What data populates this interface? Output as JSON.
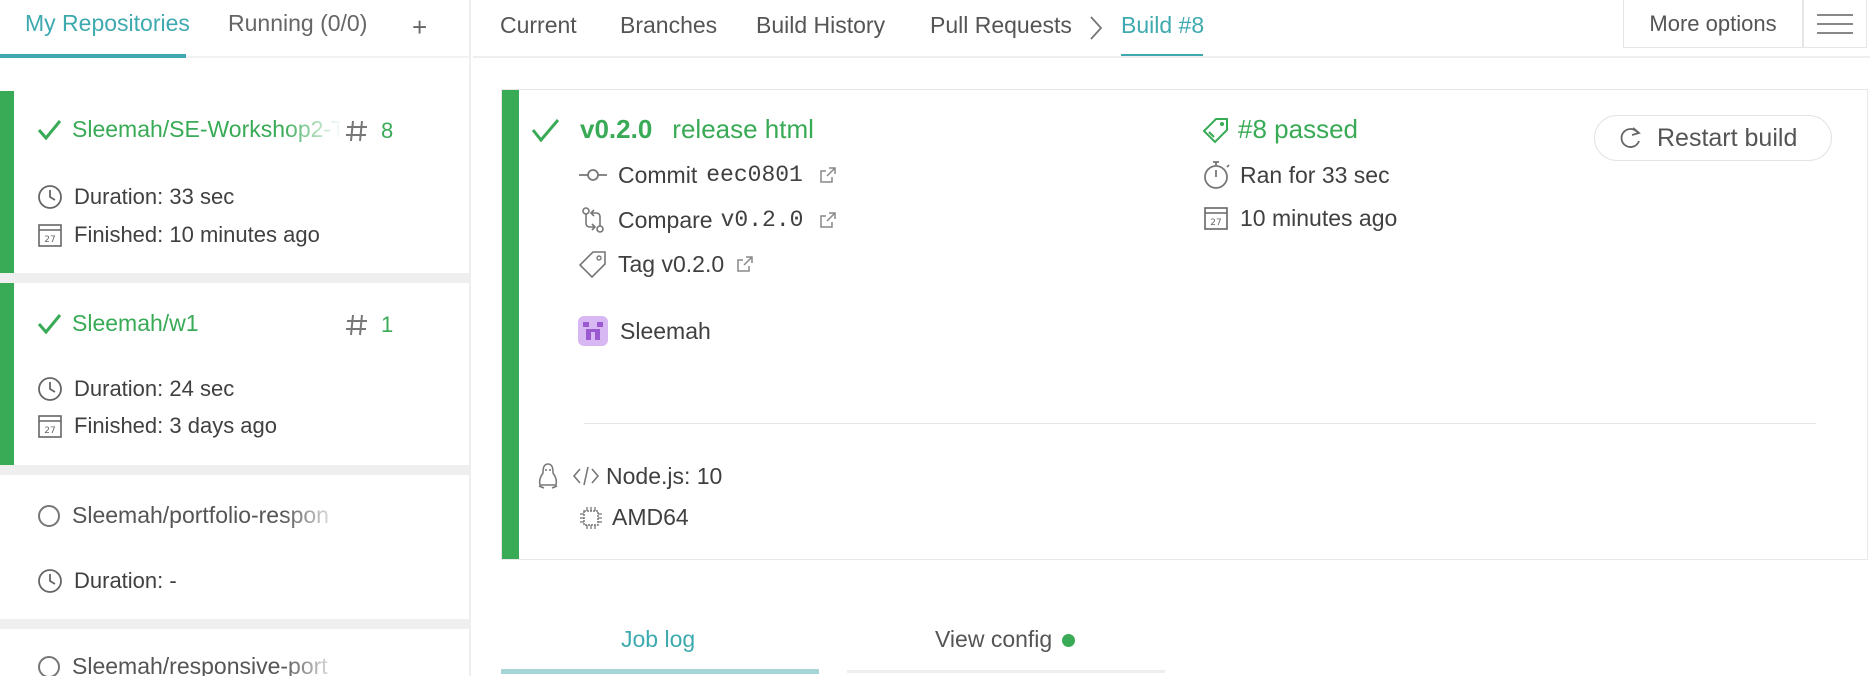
{
  "colors": {
    "passed": "#39aa56",
    "accent": "#3eaaaf",
    "text": "#404040"
  },
  "sidebar": {
    "tabs": [
      {
        "label": "My Repositories",
        "active": true
      },
      {
        "label": "Running (0/0)",
        "active": false
      }
    ],
    "add_label": "+",
    "repos": [
      {
        "status": "passed",
        "name": "Sleemah/SE-Workshop2-T",
        "number": "8",
        "duration": "Duration: 33 sec",
        "finished": "Finished: 10 minutes ago",
        "calendar_day": "27"
      },
      {
        "status": "passed",
        "name": "Sleemah/w1",
        "number": "1",
        "duration": "Duration: 24 sec",
        "finished": "Finished: 3 days ago",
        "calendar_day": "27"
      },
      {
        "status": "none",
        "name": "Sleemah/portfolio-respon",
        "duration": "Duration: -"
      },
      {
        "status": "none",
        "name": "Sleemah/responsive-port"
      }
    ]
  },
  "topnav": {
    "tabs": [
      "Current",
      "Branches",
      "Build History",
      "Pull Requests"
    ],
    "active_tab": "Build #8",
    "more_options": "More options"
  },
  "build": {
    "version": "v0.2.0",
    "message": "release html",
    "status": "#8 passed",
    "restart_label": "Restart build",
    "commit_label": "Commit",
    "commit_hash": "eec0801",
    "compare_label": "Compare",
    "compare_ref": "v0.2.0",
    "tag": "Tag v0.2.0",
    "ran_for": "Ran for 33 sec",
    "finished": "10 minutes ago",
    "calendar_day": "27",
    "author": "Sleemah",
    "language": "Node.js: 10",
    "arch": "AMD64"
  },
  "bottom_tabs": {
    "job_log": "Job log",
    "view_config": "View config"
  }
}
